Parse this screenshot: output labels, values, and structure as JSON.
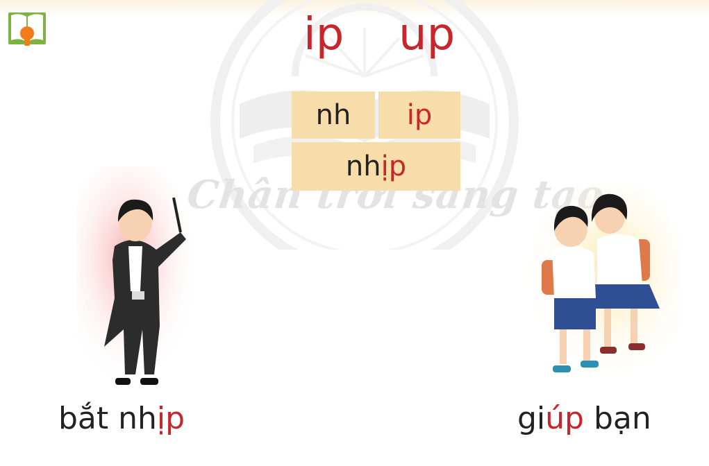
{
  "watermark": {
    "text": "Chân trời sáng tạo"
  },
  "header": {
    "rhyme_1": "ip",
    "rhyme_2": "up"
  },
  "spelling": {
    "initial": "nh",
    "rhyme": "ip",
    "word_prefix": "nh",
    "word_tone": "ị",
    "word_suffix": "p"
  },
  "examples": [
    {
      "normal": "bắt nh",
      "red": "ịp",
      "normal2": ""
    },
    {
      "normal": "gi",
      "red": "úp",
      "normal2": " bạn"
    }
  ],
  "colors": {
    "accent": "#c9262c",
    "box": "#f6ddaa",
    "icon": "#7cb342"
  }
}
